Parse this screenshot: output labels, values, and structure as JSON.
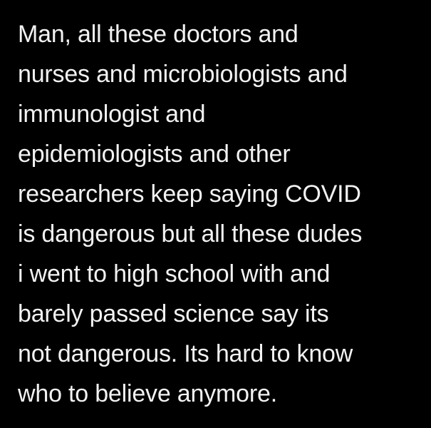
{
  "post": {
    "lines": [
      "Man, all these doctors and",
      "nurses and microbiologists and",
      "immunologist and",
      "epidemiologists and other",
      "researchers keep saying COVID",
      "is dangerous but all these dudes",
      "i went to high school with and",
      "barely passed science say its",
      "not dangerous. Its hard to know",
      "who to believe anymore."
    ]
  },
  "colors": {
    "background": "#000000",
    "text": "#f2f2f2"
  }
}
